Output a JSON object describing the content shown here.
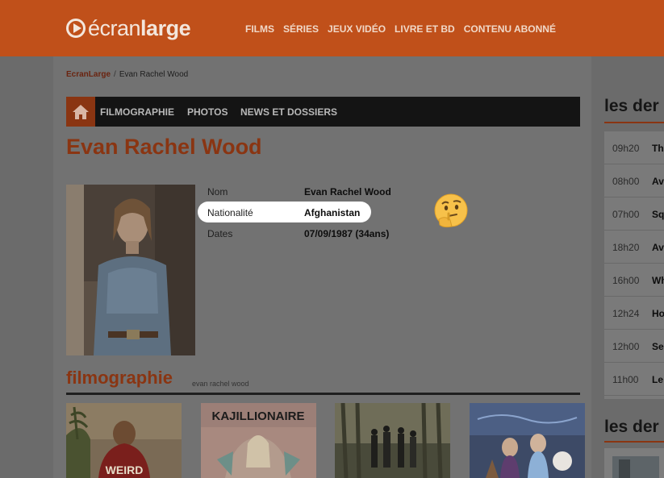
{
  "header": {
    "logo_light": "écran",
    "logo_bold": "large",
    "nav": [
      "FILMS",
      "SÉRIES",
      "JEUX VIDÉO",
      "LIVRE ET BD",
      "CONTENU ABONNÉ"
    ]
  },
  "breadcrumb": {
    "home": "EcranLarge",
    "separator": "/",
    "current": "Evan Rachel Wood"
  },
  "tabs": [
    "FILMOGRAPHIE",
    "PHOTOS",
    "NEWS ET DOSSIERS"
  ],
  "person": {
    "name": "Evan Rachel Wood",
    "info": [
      {
        "label": "Nom",
        "value": "Evan Rachel Wood"
      },
      {
        "label": "Nationalité",
        "value": "Afghanistan"
      },
      {
        "label": "Dates",
        "value": "07/09/1987 (34ans)"
      }
    ]
  },
  "filmography": {
    "title": "filmographie",
    "subtitle": "evan rachel wood",
    "posters": [
      {
        "title": "WEIRD"
      },
      {
        "title": "KAJILLIONAIRE"
      },
      {
        "title": ""
      },
      {
        "title": ""
      }
    ]
  },
  "sidebar": {
    "heading_1": "les der",
    "heading_2": "les der",
    "items": [
      {
        "time": "09h20",
        "text": "Th"
      },
      {
        "time": "08h00",
        "text": "Av"
      },
      {
        "time": "07h00",
        "text": "Sq"
      },
      {
        "time": "18h20",
        "text": "Av"
      },
      {
        "time": "16h00",
        "text": "Wh"
      },
      {
        "time": "12h24",
        "text": "Ho"
      },
      {
        "time": "12h00",
        "text": "Se"
      },
      {
        "time": "11h00",
        "text": "Le"
      }
    ]
  },
  "colors": {
    "brand": "#c0501a",
    "accent_dark": "#8a3512",
    "overlay_bg": "#6b6b6b"
  },
  "icons": {
    "home": "home-icon",
    "emoji": "thinking-face-emoji"
  }
}
